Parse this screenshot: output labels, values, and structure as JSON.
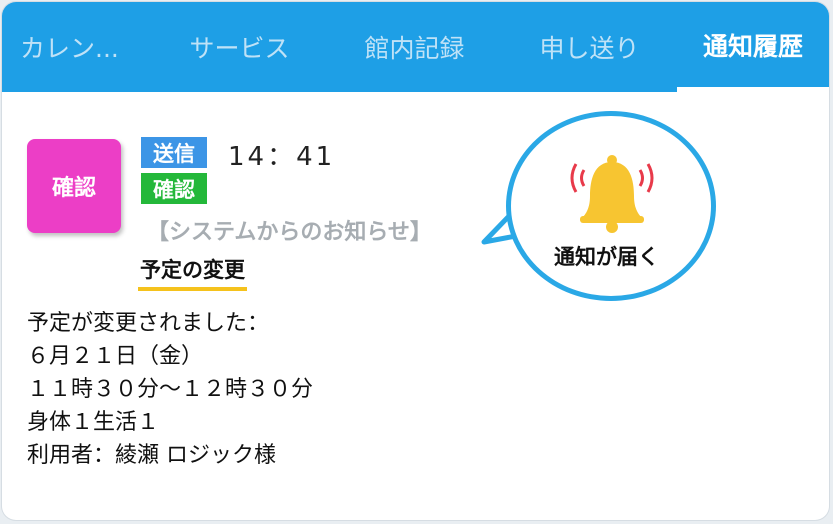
{
  "tabs": [
    {
      "label": "カレン..."
    },
    {
      "label": "サービス"
    },
    {
      "label": "館内記録"
    },
    {
      "label": "申し送り"
    },
    {
      "label": "通知履歴",
      "active": true
    }
  ],
  "notification": {
    "icon_label": "確認",
    "badge_send": "送信",
    "badge_confirm": "確認",
    "time": "14：41",
    "system_label": "【システムからのお知らせ】",
    "subject": "予定の変更",
    "body_lines": [
      "予定が変更されました：",
      "６月２１日（金）",
      "１１時３０分～１２時３０分",
      "身体１生活１",
      "利用者：綾瀬 ロジック様"
    ]
  },
  "callout": {
    "text": "通知が届く",
    "icon": "bell-icon"
  },
  "colors": {
    "tabbar": "#1e9fe6",
    "icon_button": "#ec3ec6",
    "badge_send": "#3c95e6",
    "badge_confirm": "#24b83a",
    "underline": "#f5c21c",
    "bell": "#f7c531",
    "ring": "#2aa8e6"
  }
}
